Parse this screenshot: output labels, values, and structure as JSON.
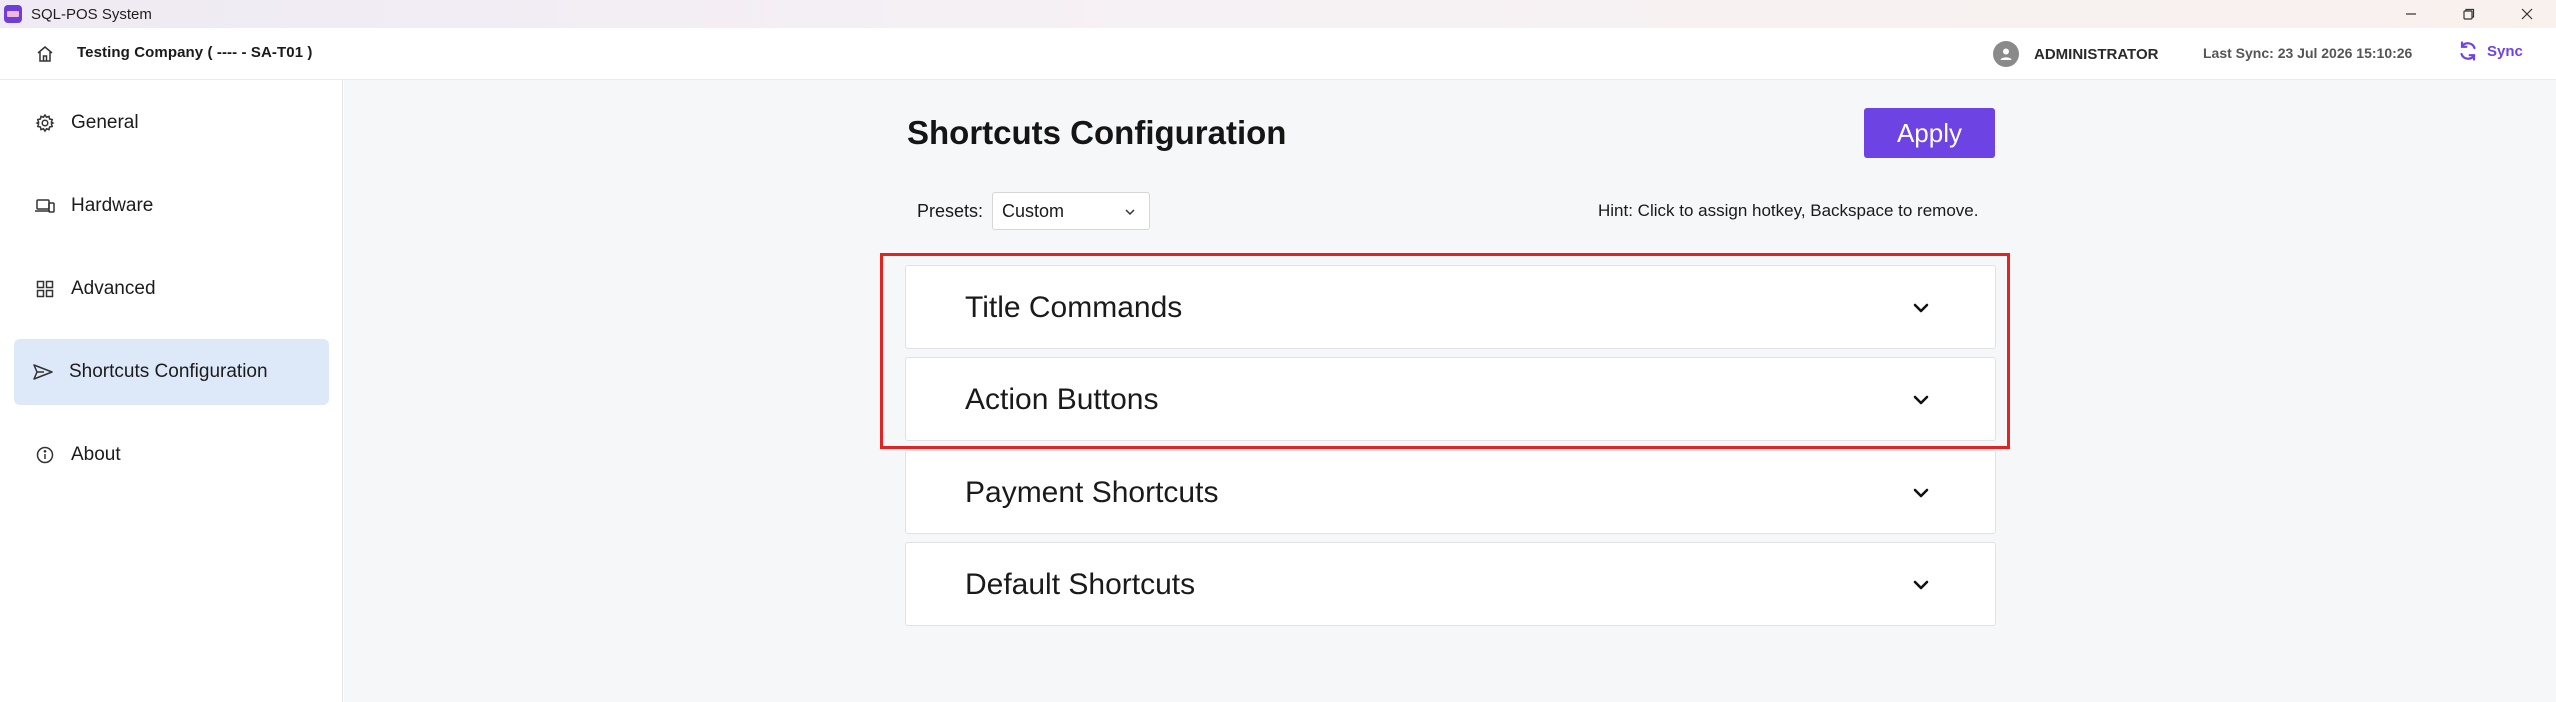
{
  "window": {
    "title": "SQL-POS System"
  },
  "header": {
    "company": "Testing Company ( ---- - SA-T01 )",
    "user": "ADMINISTRATOR",
    "last_sync": "Last Sync: 23 Jul 2026 15:10:26",
    "sync_label": "Sync"
  },
  "sidebar": {
    "items": [
      {
        "label": "General",
        "icon": "gear-icon"
      },
      {
        "label": "Hardware",
        "icon": "devices-icon"
      },
      {
        "label": "Advanced",
        "icon": "grid-icon"
      },
      {
        "label": "Shortcuts Configuration",
        "icon": "send-icon",
        "active": true
      },
      {
        "label": "About",
        "icon": "info-icon"
      }
    ]
  },
  "main": {
    "title": "Shortcuts Configuration",
    "apply_label": "Apply",
    "presets_label": "Presets:",
    "presets_value": "Custom",
    "hint": "Hint: Click to assign hotkey, Backspace to remove.",
    "sections": [
      {
        "label": "Title Commands"
      },
      {
        "label": "Action Buttons"
      },
      {
        "label": "Payment Shortcuts"
      },
      {
        "label": "Default Shortcuts"
      }
    ]
  },
  "colors": {
    "accent": "#6d43e4",
    "sidebar_active": "#dde8f8",
    "highlight": "#e02424",
    "main_bg": "#f6f7f9"
  }
}
